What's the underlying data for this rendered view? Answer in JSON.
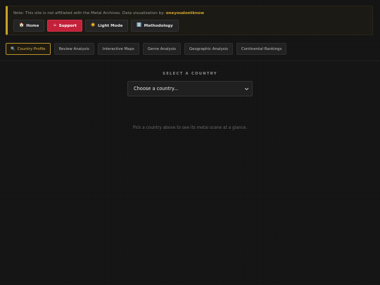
{
  "notice": {
    "text": "Note: This site is not affiliated with the Metal Archives. Data visualization by: ",
    "author": "oneyoudontknow"
  },
  "buttons": [
    {
      "icon": "🏠",
      "label": "Home"
    },
    {
      "icon": "☕",
      "label": "Support"
    },
    {
      "icon": "☀️",
      "label": "Light Mode"
    },
    {
      "icon": "ℹ️",
      "label": "Methodology"
    }
  ],
  "tabs": [
    {
      "icon": "🔍",
      "label": "Country Profile",
      "active": true
    },
    {
      "label": "Review Analysis"
    },
    {
      "label": "Interactive Maps"
    },
    {
      "label": "Genre Analysis"
    },
    {
      "label": "Geographic Analysis"
    },
    {
      "label": "Continental Rankings"
    }
  ],
  "selector": {
    "label": "SELECT A COUNTRY",
    "value": "Choose a country..."
  },
  "hint": "Pick a country above to see its metal scene at a glance.",
  "colors": {
    "accent": "#c9a227",
    "support": "#c3213a",
    "background": "#131313"
  }
}
